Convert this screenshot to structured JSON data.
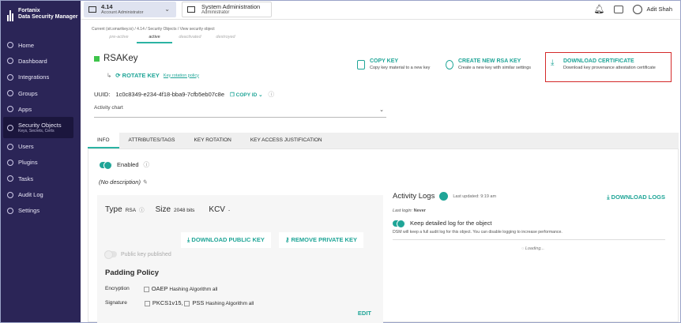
{
  "brand": {
    "line1": "Fortanix",
    "line2": "Data Security Manager"
  },
  "sidebar": {
    "items": [
      {
        "label": "Home",
        "icon": "home-icon"
      },
      {
        "label": "Dashboard",
        "icon": "dashboard-icon"
      },
      {
        "label": "Integrations",
        "icon": "integrations-icon"
      },
      {
        "label": "Groups",
        "icon": "groups-icon"
      },
      {
        "label": "Apps",
        "icon": "apps-icon"
      },
      {
        "label": "Security Objects",
        "sub": "Keys, Secrets, Certs",
        "icon": "security-objects-icon",
        "active": true
      },
      {
        "label": "Users",
        "icon": "users-icon"
      },
      {
        "label": "Plugins",
        "icon": "plugins-icon"
      },
      {
        "label": "Tasks",
        "icon": "tasks-icon"
      },
      {
        "label": "Audit Log",
        "icon": "audit-log-icon"
      },
      {
        "label": "Settings",
        "icon": "settings-icon"
      }
    ]
  },
  "topbar": {
    "account_version": "4.14",
    "account_role": "Account Administrator",
    "sys_title": "System Administration",
    "sys_sub": "Administrator",
    "user_name": "Adit Shah"
  },
  "breadcrumb": {
    "text": "Current (sit.smartkey.io) / 4.14 / Security Objects / View security object"
  },
  "state_tabs": [
    "pre-active",
    "active",
    "deactivated",
    "destroyed"
  ],
  "key": {
    "name": "RSAKey",
    "rotate_label": "ROTATE KEY",
    "rotate_link": "Key rotation policy",
    "uuid_label": "UUID:",
    "uuid": "1c0c8349-e234-4f18-bba9-7cfb5eb07c8e",
    "copy_id": "COPY ID",
    "activity_chart": "Activity chart"
  },
  "actions": {
    "copy_title": "COPY KEY",
    "copy_desc": "Copy key material to a new key",
    "create_title": "CREATE NEW RSA KEY",
    "create_desc": "Create a new key with similar settings",
    "download_title": "DOWNLOAD CERTIFICATE",
    "download_desc": "Download key provenance attestation certificate"
  },
  "tabs": [
    "INFO",
    "ATTRIBUTES/TAGS",
    "KEY ROTATION",
    "KEY ACCESS JUSTIFICATION"
  ],
  "info": {
    "enabled_label": "Enabled",
    "description": "(No description)",
    "type_label": "Type",
    "type_value": "RSA",
    "size_label": "Size",
    "size_value": "2048 bits",
    "kcv_label": "KCV",
    "kcv_value": "-",
    "download_public": "DOWNLOAD PUBLIC KEY",
    "remove_private": "REMOVE PRIVATE KEY",
    "public_published": "Public key published",
    "padding_title": "Padding Policy",
    "enc_label": "Encryption",
    "enc_value": "OAEP",
    "enc_hash": "Hashing Algorithm all",
    "sig_label": "Signature",
    "sig_value1": "PKCS1v15,",
    "sig_value2": "PSS",
    "sig_hash": "Hashing Algorithm all",
    "edit": "EDIT"
  },
  "logs": {
    "title": "Activity Logs",
    "updated": "Last updated: 9:19 am",
    "download": "DOWNLOAD LOGS",
    "last_login_label": "Last login:",
    "last_login_value": "Never",
    "keep_label": "Keep detailed log for the object",
    "note": "DSM will keep a full audit log for this object. You can disable logging to increase performance.",
    "loading": "Loading..."
  },
  "colors": {
    "accent": "#1fa597",
    "sidebar": "#2b2557",
    "highlight": "#d42a2a"
  }
}
